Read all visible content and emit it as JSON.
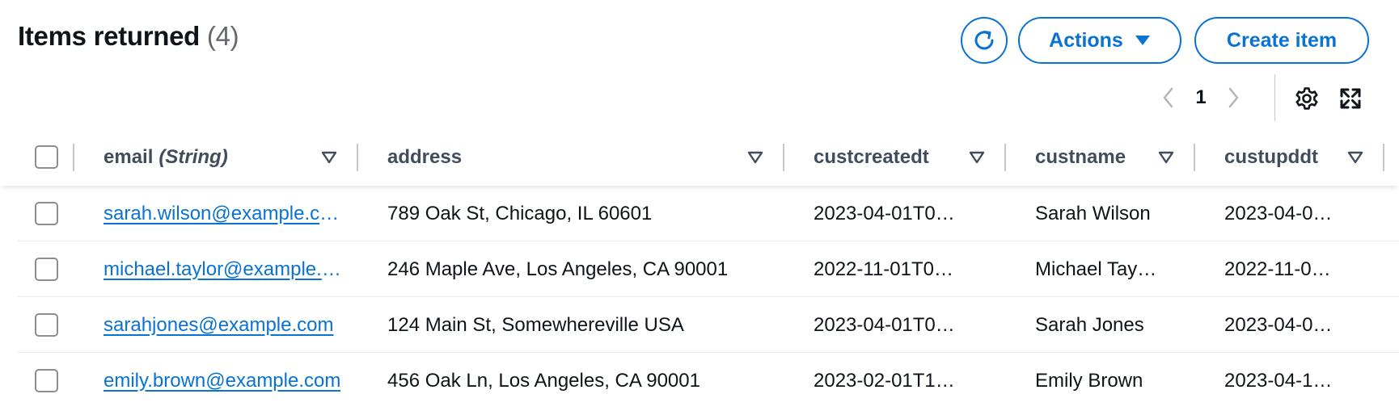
{
  "header": {
    "title": "Items returned",
    "count": "(4)",
    "refresh_icon": "refresh-icon",
    "actions_label": "Actions",
    "create_label": "Create item"
  },
  "pagination": {
    "current_page": "1",
    "prev_icon": "chevron-left-icon",
    "next_icon": "chevron-right-icon",
    "settings_icon": "gear-icon",
    "fullscreen_icon": "expand-icon"
  },
  "table": {
    "columns": [
      {
        "name": "email",
        "type": "(String)"
      },
      {
        "name": "address",
        "type": ""
      },
      {
        "name": "custcreatedt",
        "type": ""
      },
      {
        "name": "custname",
        "type": ""
      },
      {
        "name": "custupddt",
        "type": ""
      }
    ],
    "rows": [
      {
        "email": "sarah.wilson@example.com",
        "address": "789 Oak St, Chicago, IL 60601",
        "custcreatedt": "2023-04-01T0…",
        "custname": "Sarah Wilson",
        "custupddt": "2023-04-0…"
      },
      {
        "email": "michael.taylor@example.com",
        "address": "246 Maple Ave, Los Angeles, CA 90001",
        "custcreatedt": "2022-11-01T0…",
        "custname": "Michael Tay…",
        "custupddt": "2022-11-0…"
      },
      {
        "email": "sarahjones@example.com",
        "address": "124 Main St, Somewhereville USA",
        "custcreatedt": "2023-04-01T0…",
        "custname": "Sarah Jones",
        "custupddt": "2023-04-0…"
      },
      {
        "email": "emily.brown@example.com",
        "address": "456 Oak Ln, Los Angeles, CA 90001",
        "custcreatedt": "2023-02-01T1…",
        "custname": "Emily Brown",
        "custupddt": "2023-04-1…"
      }
    ]
  },
  "colors": {
    "accent": "#0972d3",
    "text": "#0f141a",
    "muted": "#656871",
    "header_text": "#414d5c",
    "border": "#c6c6cd",
    "row_divider": "#e9ebed"
  }
}
